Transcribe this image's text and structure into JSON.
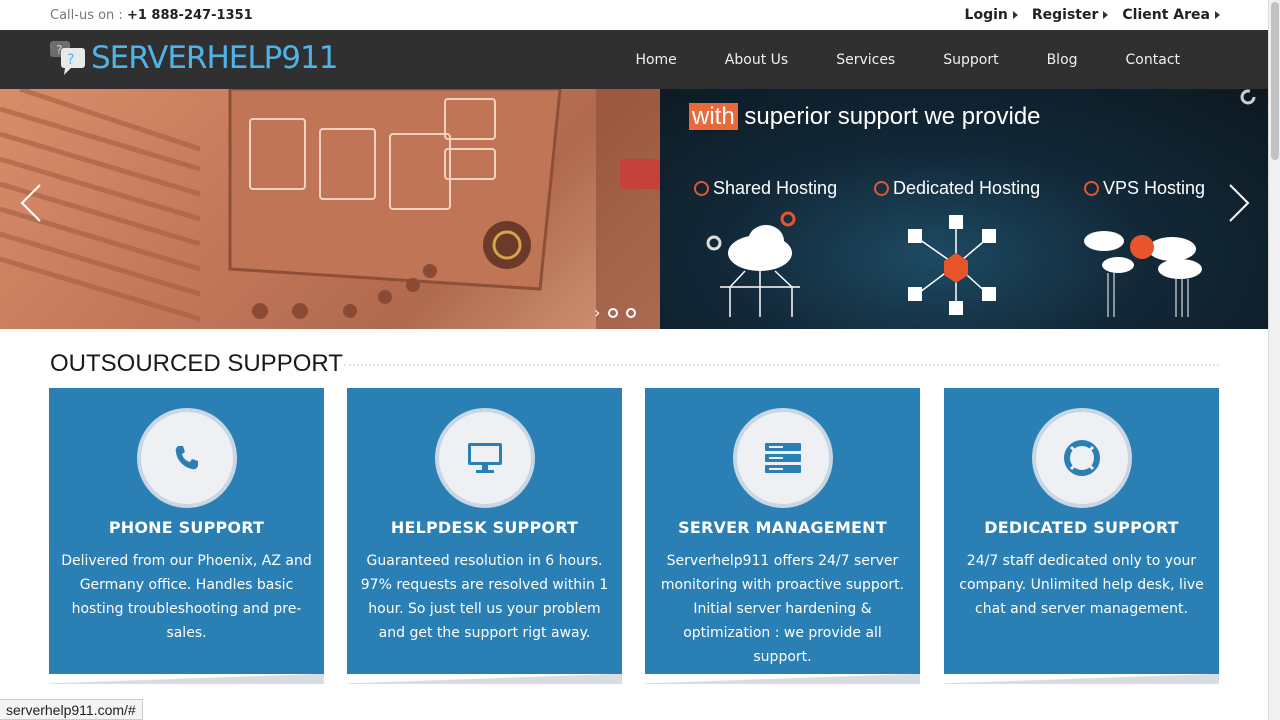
{
  "topbar": {
    "call_label": "Call-us on :",
    "phone": "+1 888-247-1351",
    "links": [
      "Login",
      "Register",
      "Client Area"
    ]
  },
  "navbar": {
    "logo_text": "SERVERHELP911",
    "items": [
      "Home",
      "About Us",
      "Services",
      "Support",
      "Blog",
      "Contact"
    ]
  },
  "slider": {
    "tagline_highlight": "with",
    "tagline_rest": " superior support we provide",
    "hosting": [
      "Shared Hosting",
      "Dedicated Hosting",
      "VPS Hosting"
    ]
  },
  "section": {
    "title": "OUTSOURCED SUPPORT"
  },
  "cards": [
    {
      "title": "PHONE SUPPORT",
      "icon": "phone-icon",
      "desc": "Delivered from our Phoenix, AZ and Germany office. Handles basic hosting troubleshooting and pre-sales."
    },
    {
      "title": "HELPDESK SUPPORT",
      "icon": "monitor-icon",
      "desc": "Guaranteed resolution in 6 hours. 97% requests are resolved within 1 hour. So just tell us your problem and get the support rigt away."
    },
    {
      "title": "SERVER MANAGEMENT",
      "icon": "server-icon",
      "desc": "Serverhelp911 offers 24/7 server monitoring with proactive support. Initial server hardening & optimization : we provide all support."
    },
    {
      "title": "DEDICATED SUPPORT",
      "icon": "lifebuoy-icon",
      "desc": "24/7 staff dedicated only to your company. Unlimited help desk, live chat and server management."
    }
  ],
  "statusbar": {
    "url": "serverhelp911.com/#"
  },
  "colors": {
    "brand_blue": "#4fb3e8",
    "card_blue": "#2a7fb5",
    "accent_orange": "#e86a3a",
    "nav_bg": "#303030"
  }
}
